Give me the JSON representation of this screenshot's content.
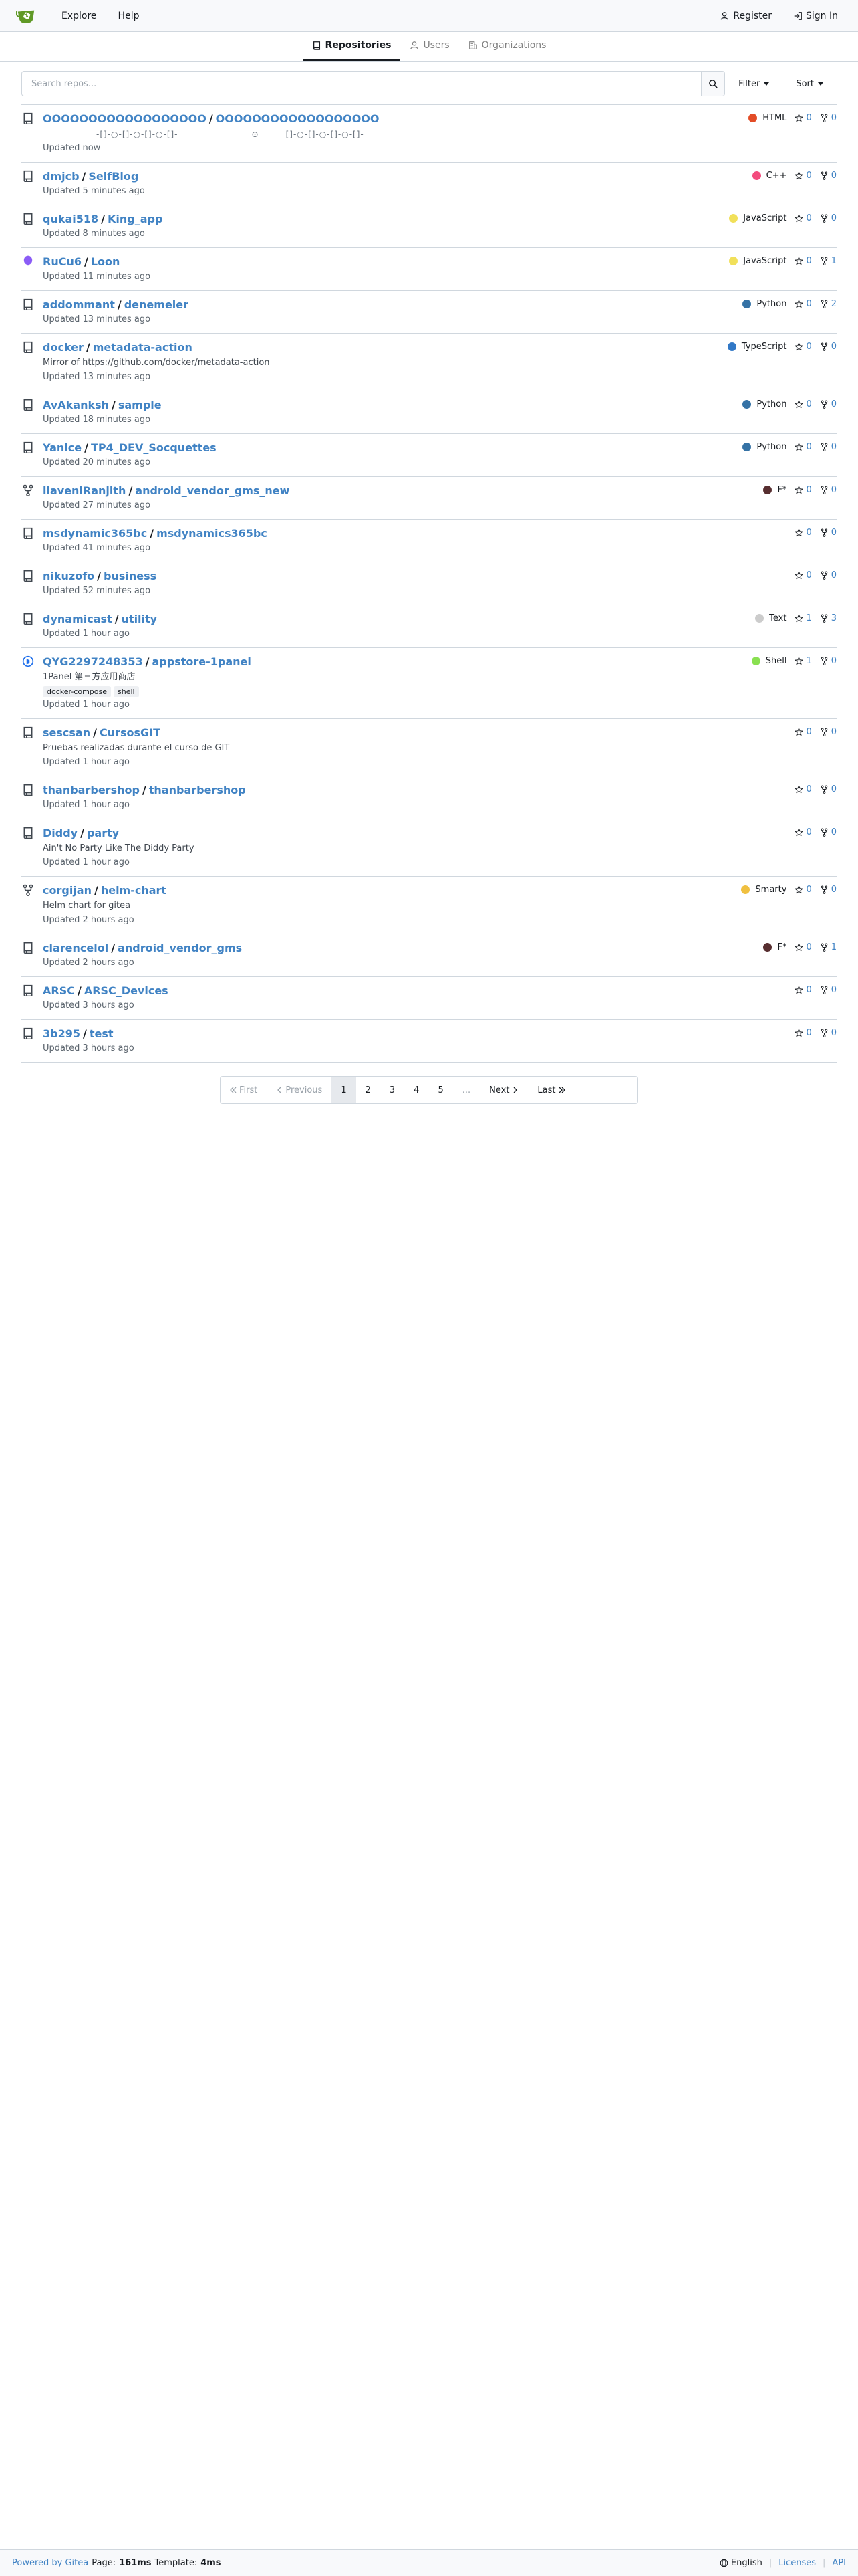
{
  "nav": {
    "explore": "Explore",
    "help": "Help",
    "register": "Register",
    "sign_in": "Sign In"
  },
  "tabs": {
    "repositories": "Repositories",
    "users": "Users",
    "organizations": "Organizations"
  },
  "search": {
    "placeholder": "Search repos...",
    "filter": "Filter",
    "sort": "Sort"
  },
  "repos": [
    {
      "owner": "OOOOOOOOOOOOOOOOOO",
      "name": "OOOOOOOOOOOOOOOOOO",
      "desc_a": "-[]-○-[]-○-[]-○-[]-",
      "desc_b": "⊙",
      "desc_c": "[]-○-[]-○-[]-○-[]-",
      "updated": "Updated now",
      "lang": "HTML",
      "lang_color": "#e34c26",
      "stars": "0",
      "forks": "0",
      "icon": "repo-icon"
    },
    {
      "owner": "dmjcb",
      "name": "SelfBlog",
      "updated": "Updated 5 minutes ago",
      "lang": "C++",
      "lang_color": "#f34b7d",
      "stars": "0",
      "forks": "0",
      "icon": "repo-icon"
    },
    {
      "owner": "qukai518",
      "name": "King_app",
      "updated": "Updated 8 minutes ago",
      "lang": "JavaScript",
      "lang_color": "#f1e05a",
      "stars": "0",
      "forks": "0",
      "icon": "repo-icon"
    },
    {
      "owner": "RuCu6",
      "name": "Loon",
      "updated": "Updated 11 minutes ago",
      "lang": "JavaScript",
      "lang_color": "#f1e05a",
      "stars": "0",
      "forks": "1",
      "icon": "balloon-icon"
    },
    {
      "owner": "addommant",
      "name": "denemeler",
      "updated": "Updated 13 minutes ago",
      "lang": "Python",
      "lang_color": "#3572a5",
      "stars": "0",
      "forks": "2",
      "icon": "repo-icon"
    },
    {
      "owner": "docker",
      "name": "metadata-action",
      "desc": "Mirror of https://github.com/docker/metadata-action",
      "updated": "Updated 13 minutes ago",
      "lang": "TypeScript",
      "lang_color": "#3178c6",
      "stars": "0",
      "forks": "0",
      "icon": "repo-icon"
    },
    {
      "owner": "AvAkanksh",
      "name": "sample",
      "updated": "Updated 18 minutes ago",
      "lang": "Python",
      "lang_color": "#3572a5",
      "stars": "0",
      "forks": "0",
      "icon": "repo-icon"
    },
    {
      "owner": "Yanice",
      "name": "TP4_DEV_Socquettes",
      "updated": "Updated 20 minutes ago",
      "lang": "Python",
      "lang_color": "#3572a5",
      "stars": "0",
      "forks": "0",
      "icon": "repo-icon"
    },
    {
      "owner": "llaveniRanjith",
      "name": "android_vendor_gms_new",
      "updated": "Updated 27 minutes ago",
      "lang": "F*",
      "lang_color": "#572e30",
      "stars": "0",
      "forks": "0",
      "icon": "fork-icon"
    },
    {
      "owner": "msdynamic365bc",
      "name": "msdynamics365bc",
      "updated": "Updated 41 minutes ago",
      "stars": "0",
      "forks": "0",
      "icon": "repo-icon"
    },
    {
      "owner": "nikuzofo",
      "name": "business",
      "updated": "Updated 52 minutes ago",
      "stars": "0",
      "forks": "0",
      "icon": "repo-icon"
    },
    {
      "owner": "dynamicast",
      "name": "utility",
      "updated": "Updated 1 hour ago",
      "lang": "Text",
      "lang_color": "#cccccc",
      "stars": "1",
      "forks": "3",
      "icon": "repo-icon"
    },
    {
      "owner": "QYG2297248353",
      "name": "appstore-1panel",
      "desc": "1Panel 第三方应用商店",
      "topics": [
        "docker-compose",
        "shell"
      ],
      "updated": "Updated 1 hour ago",
      "lang": "Shell",
      "lang_color": "#89e051",
      "stars": "1",
      "forks": "0",
      "icon": "panel-icon"
    },
    {
      "owner": "sescsan",
      "name": "CursosGIT",
      "desc": "Pruebas realizadas durante el curso de GIT",
      "updated": "Updated 1 hour ago",
      "stars": "0",
      "forks": "0",
      "icon": "repo-icon"
    },
    {
      "owner": "thanbarbershop",
      "name": "thanbarbershop",
      "updated": "Updated 1 hour ago",
      "stars": "0",
      "forks": "0",
      "icon": "repo-icon"
    },
    {
      "owner": "Diddy",
      "name": "party",
      "desc": "Ain't No Party Like The Diddy Party",
      "updated": "Updated 1 hour ago",
      "stars": "0",
      "forks": "0",
      "icon": "repo-icon"
    },
    {
      "owner": "corgijan",
      "name": "helm-chart",
      "desc": "Helm chart for gitea",
      "updated": "Updated 2 hours ago",
      "lang": "Smarty",
      "lang_color": "#f0c040",
      "stars": "0",
      "forks": "0",
      "icon": "fork-icon"
    },
    {
      "owner": "clarencelol",
      "name": "android_vendor_gms",
      "updated": "Updated 2 hours ago",
      "lang": "F*",
      "lang_color": "#572e30",
      "stars": "0",
      "forks": "1",
      "icon": "repo-icon"
    },
    {
      "owner": "ARSC",
      "name": "ARSC_Devices",
      "updated": "Updated 3 hours ago",
      "stars": "0",
      "forks": "0",
      "icon": "repo-icon"
    },
    {
      "owner": "3b295",
      "name": "test",
      "updated": "Updated 3 hours ago",
      "stars": "0",
      "forks": "0",
      "icon": "repo-icon"
    }
  ],
  "pagination": {
    "first": "First",
    "previous": "Previous",
    "pages": [
      "1",
      "2",
      "3",
      "4",
      "5"
    ],
    "ellipsis": "...",
    "next": "Next",
    "last": "Last",
    "current": "1"
  },
  "footer": {
    "powered_by": "Powered by Gitea",
    "page_label": "Page:",
    "page_time": "161ms",
    "template_label": "Template:",
    "template_time": "4ms",
    "language": "English",
    "licenses": "Licenses",
    "api": "API"
  },
  "colors": {
    "brand_green": "#609926",
    "link": "#4183c4"
  }
}
